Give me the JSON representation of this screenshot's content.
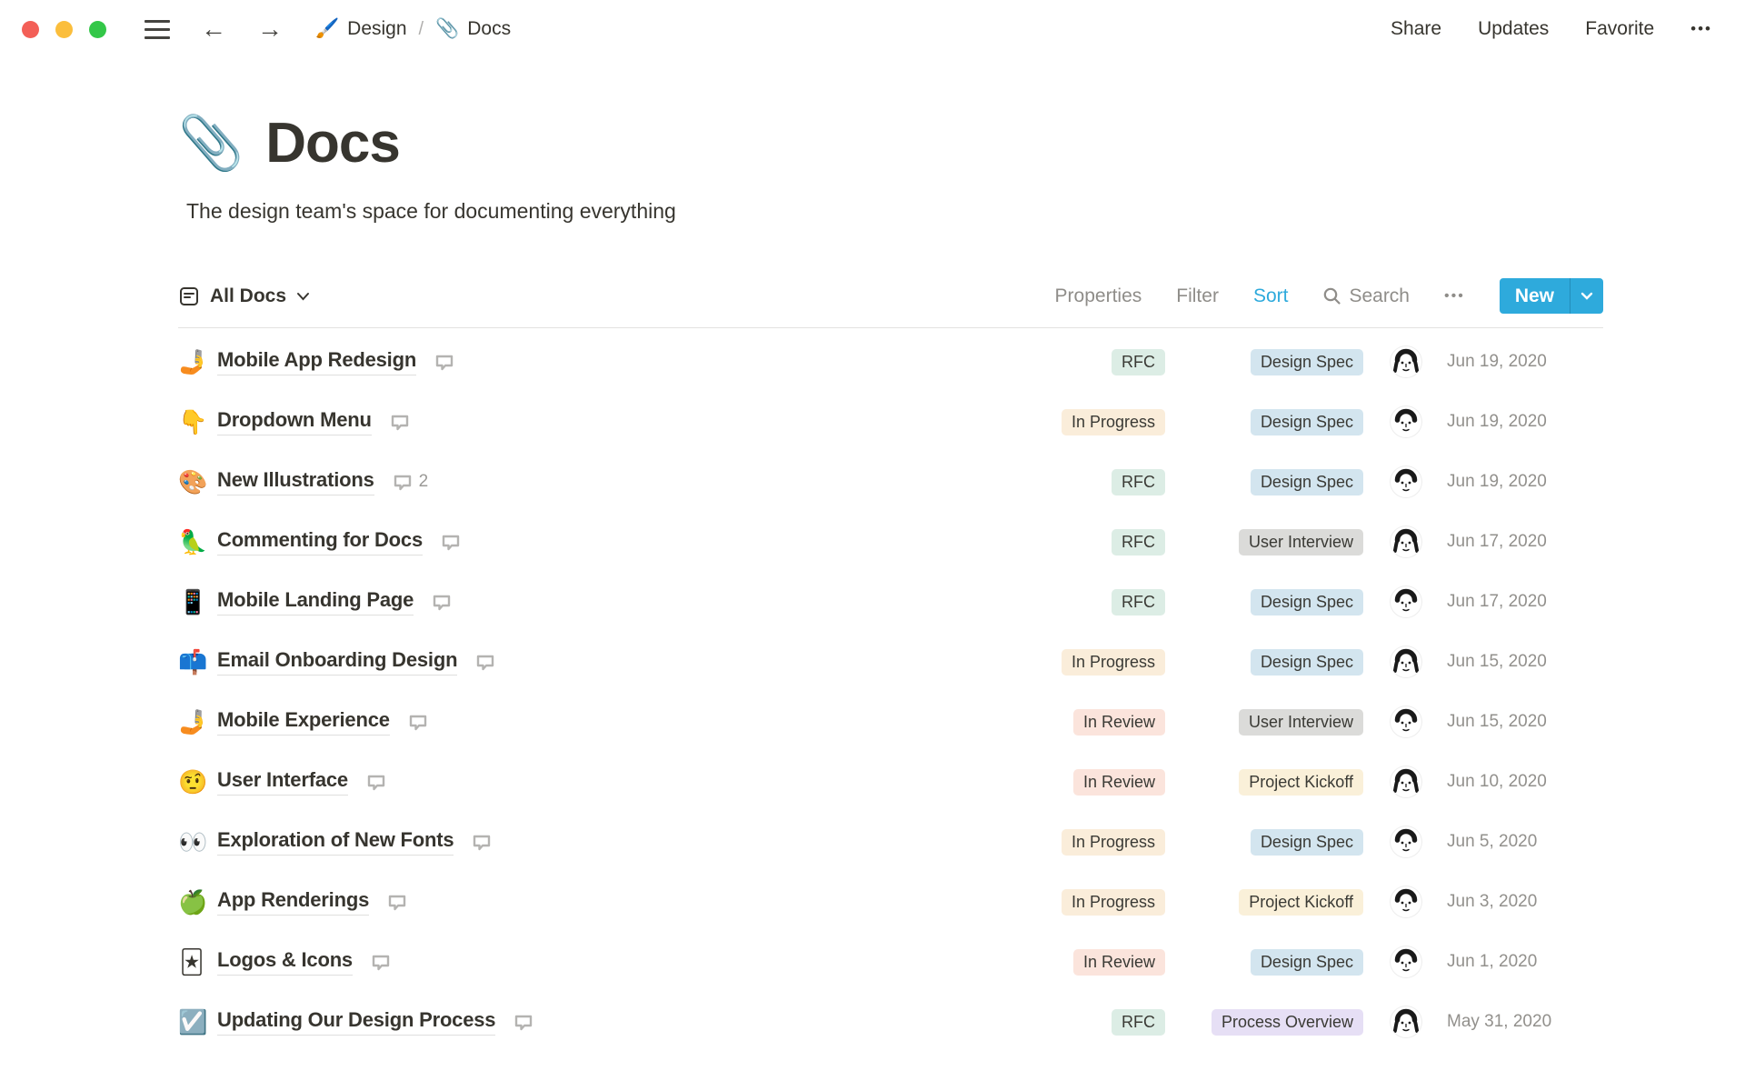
{
  "window": {
    "traffic_lights": {
      "close": "#F35F57",
      "minimize": "#FBBE3C",
      "zoom": "#33C748"
    }
  },
  "topbar": {
    "breadcrumb": [
      {
        "icon": "🖌️",
        "label": "Design"
      },
      {
        "icon": "📎",
        "label": "Docs"
      }
    ],
    "separator": "/",
    "actions": {
      "share": "Share",
      "updates": "Updates",
      "favorite": "Favorite"
    },
    "more_label": "•••"
  },
  "page": {
    "icon": "📎",
    "title": "Docs",
    "subtitle": "The design team's space for documenting everything"
  },
  "toolbar": {
    "view_label": "All Docs",
    "menu": [
      "Properties",
      "Filter",
      "Sort"
    ],
    "active_menu": "Sort",
    "search_label": "Search",
    "more_label": "•••",
    "new_label": "New"
  },
  "colors": {
    "accent_blue": "#2EAADC",
    "tag_colors": {
      "RFC": "#DCEDE5",
      "In Progress": "#FAEDDA",
      "In Review": "#FBE4DC",
      "Design Spec": "#D3E5EF",
      "User Interview": "#DBDBD9",
      "Project Kickoff": "#FAF0D9",
      "Process Overview": "#E6DFF5"
    }
  },
  "table": {
    "rows": [
      {
        "icon": "🤳",
        "title": "Mobile App Redesign",
        "comments": null,
        "status": "RFC",
        "category": "Design Spec",
        "avatar": "f",
        "date": "Jun 19, 2020"
      },
      {
        "icon": "👇",
        "title": "Dropdown Menu",
        "comments": null,
        "status": "In Progress",
        "category": "Design Spec",
        "avatar": "m",
        "date": "Jun 19, 2020"
      },
      {
        "icon": "🎨",
        "title": "New Illustrations",
        "comments": 2,
        "status": "RFC",
        "category": "Design Spec",
        "avatar": "m",
        "date": "Jun 19, 2020"
      },
      {
        "icon": "🦜",
        "title": "Commenting for Docs",
        "comments": null,
        "status": "RFC",
        "category": "User Interview",
        "avatar": "f",
        "date": "Jun 17, 2020"
      },
      {
        "icon": "📱",
        "title": "Mobile Landing Page",
        "comments": null,
        "status": "RFC",
        "category": "Design Spec",
        "avatar": "m",
        "date": "Jun 17, 2020"
      },
      {
        "icon": "📫",
        "title": "Email Onboarding Design",
        "comments": null,
        "status": "In Progress",
        "category": "Design Spec",
        "avatar": "f",
        "date": "Jun 15, 2020"
      },
      {
        "icon": "🤳",
        "title": "Mobile Experience",
        "comments": null,
        "status": "In Review",
        "category": "User Interview",
        "avatar": "m",
        "date": "Jun 15, 2020"
      },
      {
        "icon": "🤨",
        "title": "User Interface",
        "comments": null,
        "status": "In Review",
        "category": "Project Kickoff",
        "avatar": "f",
        "date": "Jun 10, 2020"
      },
      {
        "icon": "👀",
        "title": "Exploration of New Fonts",
        "comments": null,
        "status": "In Progress",
        "category": "Design Spec",
        "avatar": "m",
        "date": "Jun 5, 2020"
      },
      {
        "icon": "🍏",
        "title": "App Renderings",
        "comments": null,
        "status": "In Progress",
        "category": "Project Kickoff",
        "avatar": "m",
        "date": "Jun 3, 2020"
      },
      {
        "icon": "🃏",
        "title": "Logos & Icons",
        "comments": null,
        "status": "In Review",
        "category": "Design Spec",
        "avatar": "m",
        "date": "Jun 1, 2020"
      },
      {
        "icon": "☑️",
        "title": "Updating Our Design Process",
        "comments": null,
        "status": "RFC",
        "category": "Process Overview",
        "avatar": "f",
        "date": "May 31, 2020"
      }
    ]
  }
}
